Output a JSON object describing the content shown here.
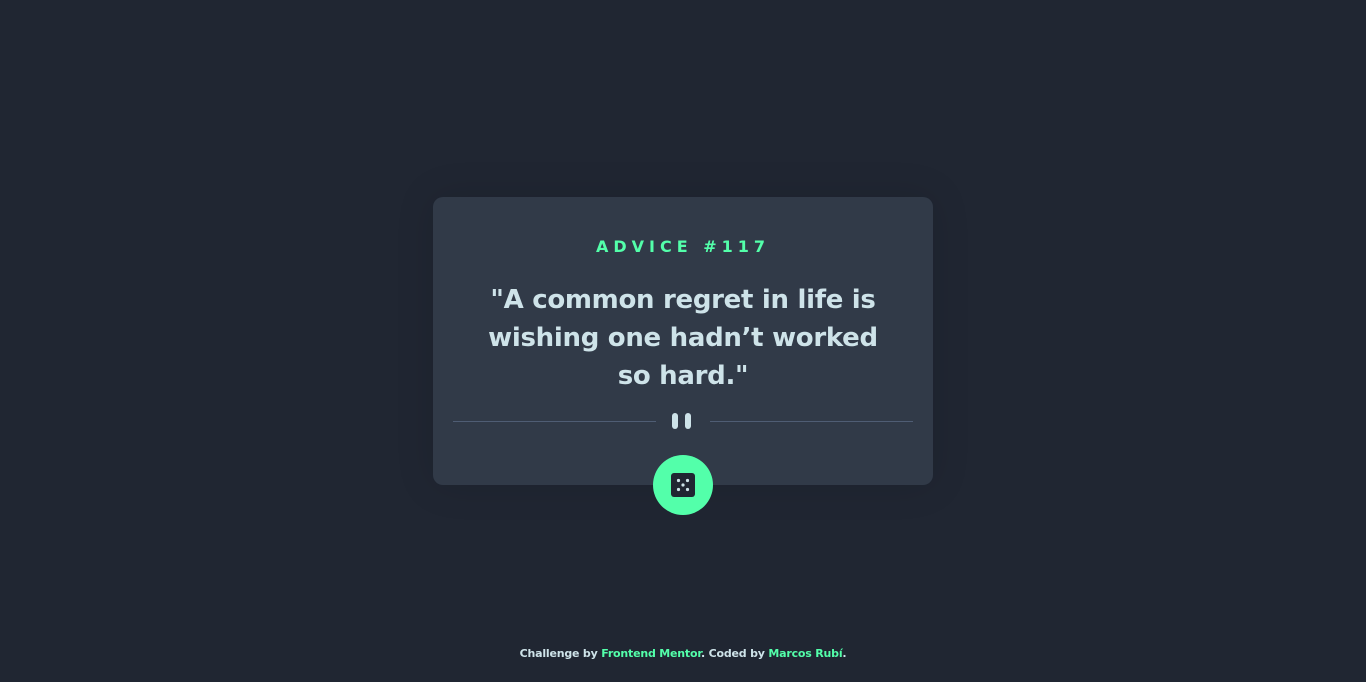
{
  "card": {
    "advice_label": "ADVICE #117",
    "quote": "\"A common regret in life is wishing one hadn’t worked so hard.\""
  },
  "button": {
    "icon": "dice-icon",
    "accent_color": "#53ffaa"
  },
  "footer": {
    "prefix": "Challenge by",
    "link1": "Frontend Mentor",
    "middle": ". Coded by",
    "link2": "Marcos Rubí",
    "suffix": "."
  },
  "colors": {
    "background": "#202632",
    "card": "#313a48",
    "accent": "#53ffaa",
    "text": "#cee3e9"
  }
}
